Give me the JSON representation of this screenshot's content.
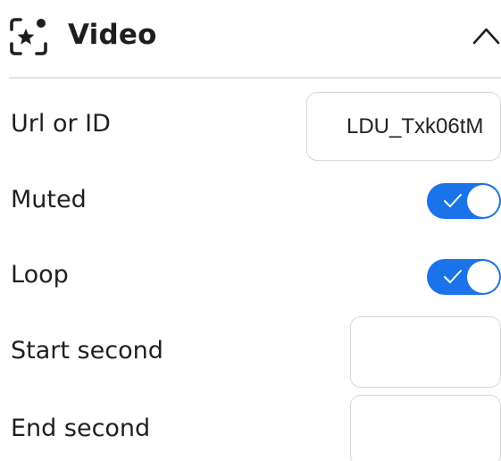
{
  "header": {
    "icon": "sparkle-video-icon",
    "title": "Video",
    "collapse_icon": "chevron-up-icon"
  },
  "fields": {
    "url": {
      "label": "Url or ID",
      "value": "LDU_Txk06tM"
    },
    "muted": {
      "label": "Muted",
      "checked": true
    },
    "loop": {
      "label": "Loop",
      "checked": true
    },
    "start": {
      "label": "Start second",
      "value": ""
    },
    "end": {
      "label": "End second",
      "value": ""
    }
  },
  "colors": {
    "toggle_on": "#1a73e8",
    "border": "#d9d9d9",
    "divider": "#e2e2e2",
    "text": "#1f1f1f"
  }
}
